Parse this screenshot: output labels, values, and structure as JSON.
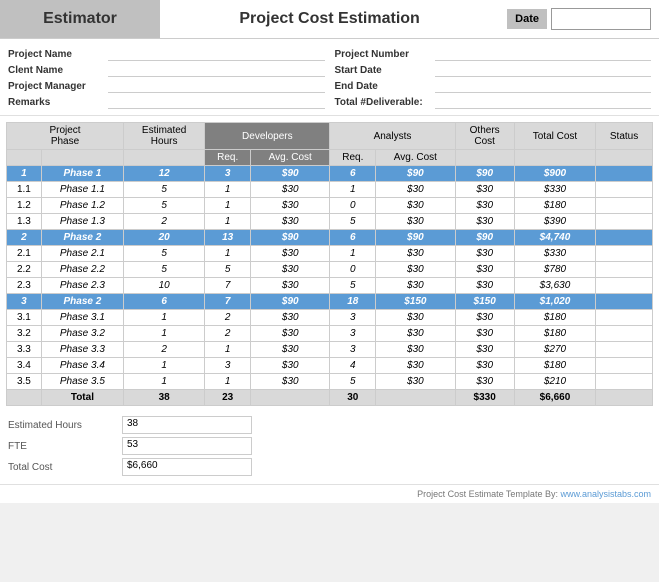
{
  "header": {
    "estimator": "Estimator",
    "title": "Project Cost Estimation",
    "date_label": "Date"
  },
  "info": {
    "left": [
      {
        "label": "Project Name",
        "value": ""
      },
      {
        "label": "Clent Name",
        "value": ""
      },
      {
        "label": "Project Manager",
        "value": ""
      },
      {
        "label": "Remarks",
        "value": ""
      }
    ],
    "right": [
      {
        "label": "Project Number",
        "value": ""
      },
      {
        "label": "Start Date",
        "value": ""
      },
      {
        "label": "End Date",
        "value": ""
      },
      {
        "label": "Total #Deliverable:",
        "value": ""
      }
    ]
  },
  "table": {
    "col_headers": {
      "project_phase": "Project\nPhase",
      "estimated_hours": "Estimated\nHours",
      "developers": "Developers",
      "analysts": "Analysts",
      "others_cost": "Others\nCost",
      "total_cost": "Total Cost",
      "status": "Status",
      "dev_req": "Req.",
      "dev_avg": "Avg. Cost",
      "ana_req": "Req.",
      "ana_avg": "Avg. Cost"
    },
    "rows": [
      {
        "type": "phase",
        "num": "1",
        "name": "Phase 1",
        "hours": "12",
        "dev_req": "3",
        "dev_avg": "$90",
        "ana_req": "6",
        "ana_avg": "$90",
        "others": "$90",
        "total": "$900",
        "status": ""
      },
      {
        "type": "sub",
        "num": "1.1",
        "name": "Phase 1.1",
        "hours": "5",
        "dev_req": "1",
        "dev_avg": "$30",
        "ana_req": "1",
        "ana_avg": "$30",
        "others": "$30",
        "total": "$330",
        "status": ""
      },
      {
        "type": "sub",
        "num": "1.2",
        "name": "Phase 1.2",
        "hours": "5",
        "dev_req": "1",
        "dev_avg": "$30",
        "ana_req": "0",
        "ana_avg": "$30",
        "others": "$30",
        "total": "$180",
        "status": ""
      },
      {
        "type": "sub",
        "num": "1.3",
        "name": "Phase 1.3",
        "hours": "2",
        "dev_req": "1",
        "dev_avg": "$30",
        "ana_req": "5",
        "ana_avg": "$30",
        "others": "$30",
        "total": "$390",
        "status": ""
      },
      {
        "type": "phase",
        "num": "2",
        "name": "Phase 2",
        "hours": "20",
        "dev_req": "13",
        "dev_avg": "$90",
        "ana_req": "6",
        "ana_avg": "$90",
        "others": "$90",
        "total": "$4,740",
        "status": ""
      },
      {
        "type": "sub",
        "num": "2.1",
        "name": "Phase 2.1",
        "hours": "5",
        "dev_req": "1",
        "dev_avg": "$30",
        "ana_req": "1",
        "ana_avg": "$30",
        "others": "$30",
        "total": "$330",
        "status": ""
      },
      {
        "type": "sub",
        "num": "2.2",
        "name": "Phase 2.2",
        "hours": "5",
        "dev_req": "5",
        "dev_avg": "$30",
        "ana_req": "0",
        "ana_avg": "$30",
        "others": "$30",
        "total": "$780",
        "status": ""
      },
      {
        "type": "sub",
        "num": "2.3",
        "name": "Phase 2.3",
        "hours": "10",
        "dev_req": "7",
        "dev_avg": "$30",
        "ana_req": "5",
        "ana_avg": "$30",
        "others": "$30",
        "total": "$3,630",
        "status": ""
      },
      {
        "type": "phase",
        "num": "3",
        "name": "Phase 2",
        "hours": "6",
        "dev_req": "7",
        "dev_avg": "$90",
        "ana_req": "18",
        "ana_avg": "$150",
        "others": "$150",
        "total": "$1,020",
        "status": ""
      },
      {
        "type": "sub",
        "num": "3.1",
        "name": "Phase 3.1",
        "hours": "1",
        "dev_req": "2",
        "dev_avg": "$30",
        "ana_req": "3",
        "ana_avg": "$30",
        "others": "$30",
        "total": "$180",
        "status": ""
      },
      {
        "type": "sub",
        "num": "3.2",
        "name": "Phase 3.2",
        "hours": "1",
        "dev_req": "2",
        "dev_avg": "$30",
        "ana_req": "3",
        "ana_avg": "$30",
        "others": "$30",
        "total": "$180",
        "status": ""
      },
      {
        "type": "sub",
        "num": "3.3",
        "name": "Phase 3.3",
        "hours": "2",
        "dev_req": "1",
        "dev_avg": "$30",
        "ana_req": "3",
        "ana_avg": "$30",
        "others": "$30",
        "total": "$270",
        "status": ""
      },
      {
        "type": "sub",
        "num": "3.4",
        "name": "Phase 3.4",
        "hours": "1",
        "dev_req": "3",
        "dev_avg": "$30",
        "ana_req": "4",
        "ana_avg": "$30",
        "others": "$30",
        "total": "$180",
        "status": ""
      },
      {
        "type": "sub",
        "num": "3.5",
        "name": "Phase 3.5",
        "hours": "1",
        "dev_req": "1",
        "dev_avg": "$30",
        "ana_req": "5",
        "ana_avg": "$30",
        "others": "$30",
        "total": "$210",
        "status": ""
      },
      {
        "type": "total",
        "num": "",
        "name": "Total",
        "hours": "38",
        "dev_req": "23",
        "dev_avg": "",
        "ana_req": "30",
        "ana_avg": "",
        "others": "$330",
        "total": "$6,660",
        "status": ""
      }
    ]
  },
  "summary": {
    "items": [
      {
        "label": "Estimated Hours",
        "value": "38"
      },
      {
        "label": "FTE",
        "value": "53"
      },
      {
        "label": "Total Cost",
        "value": "$6,660"
      }
    ]
  },
  "footer": {
    "text": "Project Cost Estimate Template By:",
    "url_text": "www.analysistabs.com"
  }
}
